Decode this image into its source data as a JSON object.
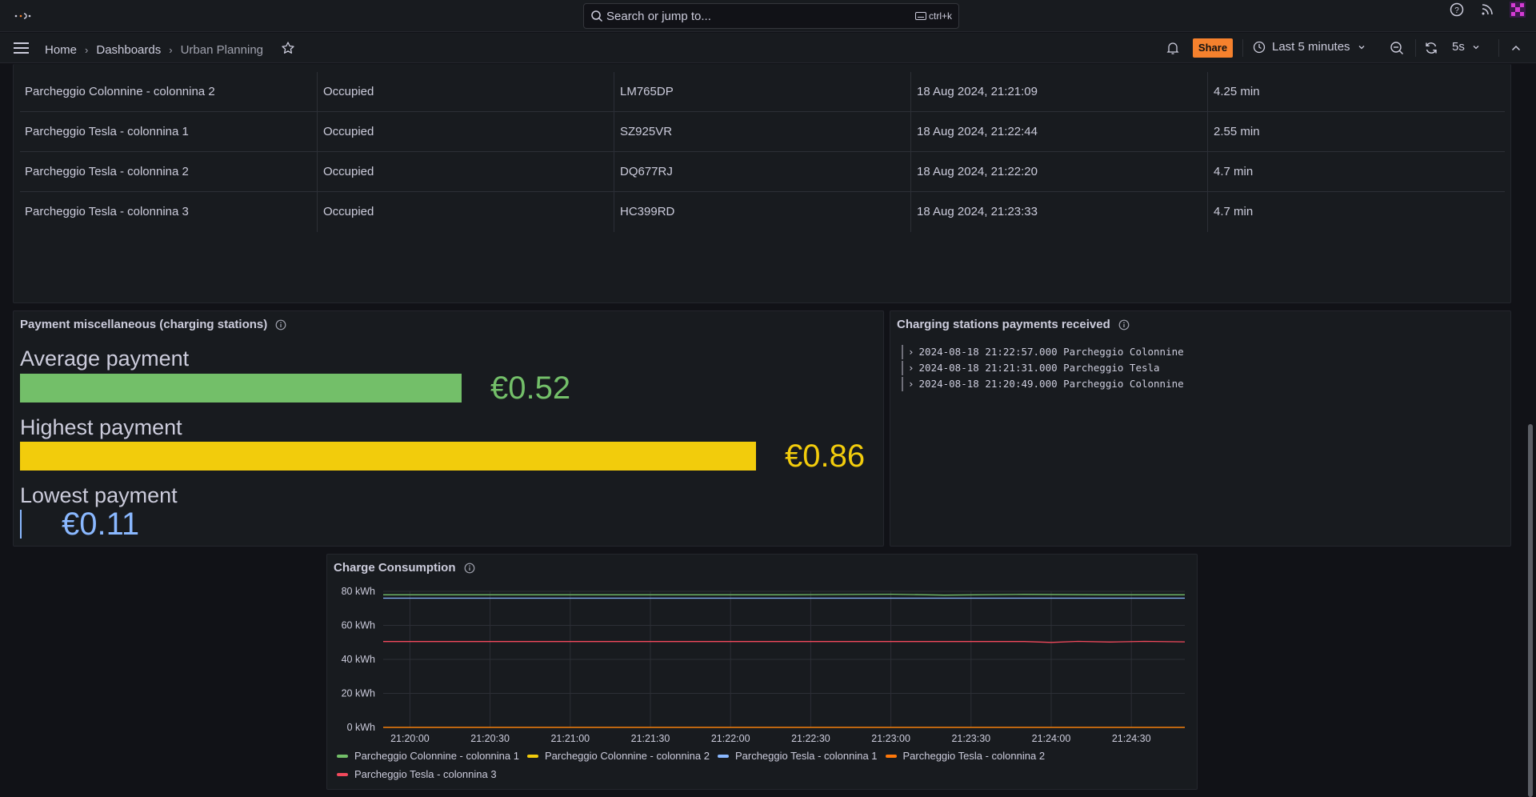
{
  "search": {
    "placeholder": "Search or jump to...",
    "shortcut": "ctrl+k"
  },
  "breadcrumb": {
    "home": "Home",
    "dashboards": "Dashboards",
    "current": "Urban Planning"
  },
  "toolbar": {
    "share_label": "Share",
    "time_range": "Last 5 minutes",
    "refresh_interval": "5s"
  },
  "table": {
    "rows": [
      {
        "station": "Parcheggio Colonnine - colonnina 2",
        "status": "Occupied",
        "plate": "LM765DP",
        "time": "18 Aug 2024, 21:21:09",
        "duration": "4.25 min"
      },
      {
        "station": "Parcheggio Tesla - colonnina 1",
        "status": "Occupied",
        "plate": "SZ925VR",
        "time": "18 Aug 2024, 21:22:44",
        "duration": "2.55 min"
      },
      {
        "station": "Parcheggio Tesla - colonnina 2",
        "status": "Occupied",
        "plate": "DQ677RJ",
        "time": "18 Aug 2024, 21:22:20",
        "duration": "4.7 min"
      },
      {
        "station": "Parcheggio Tesla - colonnina 3",
        "status": "Occupied",
        "plate": "HC399RD",
        "time": "18 Aug 2024, 21:23:33",
        "duration": "4.7 min"
      }
    ]
  },
  "payments_panel": {
    "title": "Payment miscellaneous (charging stations)",
    "gauges": [
      {
        "label": "Average payment",
        "value": "€0.52",
        "level": 0.6,
        "color": "#73bf69"
      },
      {
        "label": "Highest payment",
        "value": "€0.86",
        "level": 1.0,
        "color": "#f2cc0c"
      },
      {
        "label": "Lowest payment",
        "value": "€0.11",
        "level": 0.0,
        "color": "#8ab8ff"
      }
    ]
  },
  "logs_panel": {
    "title": "Charging stations payments received",
    "lines": [
      "2024-08-18 21:22:57.000 Parcheggio Colonnine",
      "2024-08-18 21:21:31.000 Parcheggio Tesla",
      "2024-08-18 21:20:49.000 Parcheggio Colonnine"
    ]
  },
  "chart_data": {
    "type": "line",
    "title": "Charge Consumption",
    "xlabel": "",
    "ylabel": "",
    "x_ticks": [
      "21:20:00",
      "21:20:30",
      "21:21:00",
      "21:21:30",
      "21:22:00",
      "21:22:30",
      "21:23:00",
      "21:23:30",
      "21:24:00",
      "21:24:30"
    ],
    "y_ticks": [
      "0 kWh",
      "20 kWh",
      "40 kWh",
      "60 kWh",
      "80 kWh"
    ],
    "ylim": [
      0,
      80
    ],
    "x_range_seconds": [
      -10,
      290
    ],
    "grid": true,
    "legend_position": "bottom",
    "series": [
      {
        "name": "Parcheggio Colonnine - colonnina 1",
        "color": "#73bf69",
        "points": [
          [
            -10,
            78
          ],
          [
            140,
            78
          ],
          [
            180,
            78.3
          ],
          [
            200,
            77.8
          ],
          [
            230,
            78.2
          ],
          [
            260,
            78
          ],
          [
            290,
            78
          ]
        ]
      },
      {
        "name": "Parcheggio Colonnine - colonnina 2",
        "color": "#f2cc0c",
        "points": [
          [
            -10,
            0
          ],
          [
            290,
            0
          ]
        ]
      },
      {
        "name": "Parcheggio Tesla - colonnina 1",
        "color": "#8ab8ff",
        "points": [
          [
            -10,
            76
          ],
          [
            290,
            76
          ]
        ]
      },
      {
        "name": "Parcheggio Tesla - colonnina 2",
        "color": "#ff780a",
        "points": [
          [
            -10,
            0
          ],
          [
            290,
            0
          ]
        ]
      },
      {
        "name": "Parcheggio Tesla - colonnina 3",
        "color": "#f2495c",
        "points": [
          [
            -10,
            50.5
          ],
          [
            230,
            50.5
          ],
          [
            240,
            50.0
          ],
          [
            250,
            50.6
          ],
          [
            262,
            50.2
          ],
          [
            275,
            50.6
          ],
          [
            290,
            50.3
          ]
        ]
      }
    ]
  }
}
